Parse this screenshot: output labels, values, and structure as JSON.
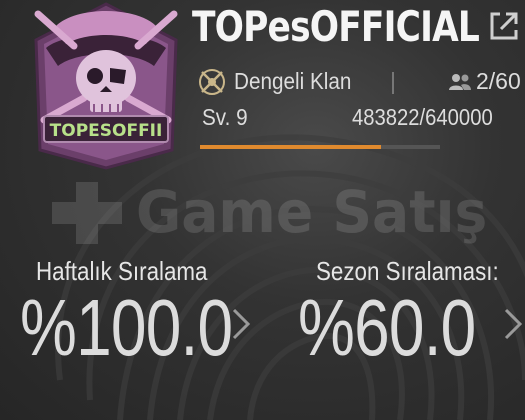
{
  "clan": {
    "name": "TOPesOFFICIAL",
    "emblem_tag": "TOPESOFFII",
    "type": "Dengeli Klan",
    "members": "2/60",
    "level": "Sv. 9",
    "xp": "483822/640000",
    "xp_progress": 0.756
  },
  "watermark": {
    "text": "Game Satış"
  },
  "rankings": {
    "weekly": {
      "label": "Haftalık Sıralama",
      "value": "%100.0"
    },
    "season": {
      "label": "Sezon Sıralaması:",
      "value": "%60.0"
    }
  },
  "colors": {
    "accent": "#e08a2e",
    "emblem_pink": "#c98fc0",
    "emblem_dark": "#6b3f6a",
    "tag_green": "#b8e08a"
  },
  "icons": [
    "pirate-emblem-icon",
    "share-icon",
    "clan-type-badge-icon",
    "members-icon",
    "chevron-right-icon"
  ]
}
